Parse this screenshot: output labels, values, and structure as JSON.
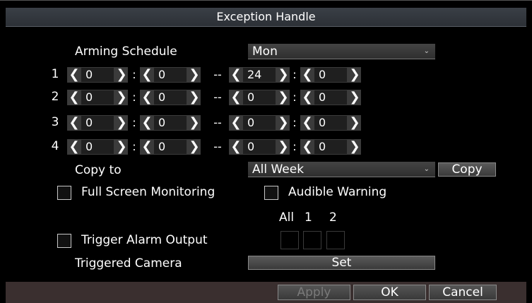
{
  "title": "Exception Handle",
  "arming": {
    "label": "Arming Schedule",
    "day": "Mon",
    "rows": [
      {
        "num": "1",
        "start_h": "0",
        "start_m": "0",
        "end_h": "24",
        "end_m": "0"
      },
      {
        "num": "2",
        "start_h": "0",
        "start_m": "0",
        "end_h": "0",
        "end_m": "0"
      },
      {
        "num": "3",
        "start_h": "0",
        "start_m": "0",
        "end_h": "0",
        "end_m": "0"
      },
      {
        "num": "4",
        "start_h": "0",
        "start_m": "0",
        "end_h": "0",
        "end_m": "0"
      }
    ],
    "time_separator": ":",
    "range_separator": "--"
  },
  "copy": {
    "label": "Copy to",
    "target": "All Week",
    "button": "Copy"
  },
  "options": {
    "full_screen": "Full Screen Monitoring",
    "audible": "Audible Warning",
    "trigger_alarm": "Trigger Alarm Output",
    "alarm_headers": [
      "All",
      "1",
      "2"
    ]
  },
  "camera": {
    "label": "Triggered Camera",
    "button": "Set"
  },
  "footer": {
    "apply": "Apply",
    "ok": "OK",
    "cancel": "Cancel"
  },
  "icons": {
    "dec": "chevron-left-icon",
    "inc": "chevron-right-icon",
    "dropdown": "chevron-down-icon"
  },
  "colors": {
    "background": "#000000",
    "bar": "#2c3036",
    "footer_bar": "#3a2f2f"
  }
}
